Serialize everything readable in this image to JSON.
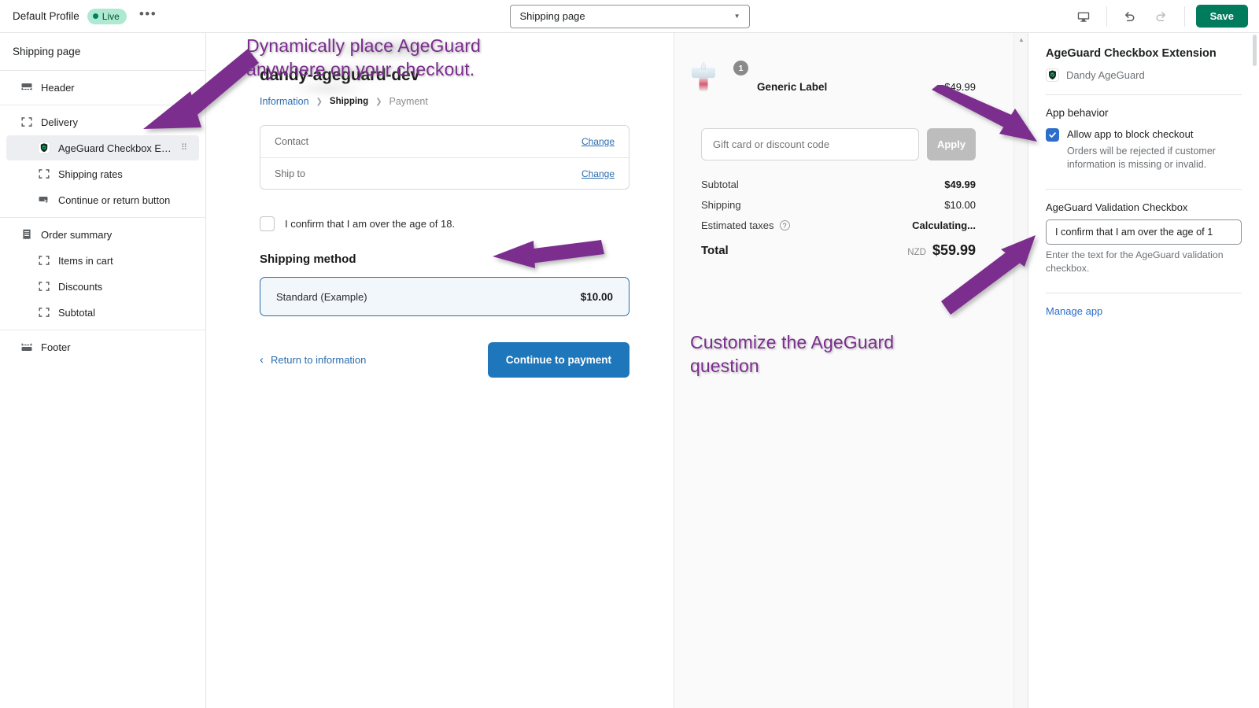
{
  "topbar": {
    "profile_name": "Default Profile",
    "status_badge": "Live",
    "more_label": "•••",
    "page_selector_value": "Shipping page",
    "preview_device_icon": "desktop-monitor-icon",
    "undo_icon": "undo-arrow-icon",
    "redo_icon": "redo-arrow-icon",
    "save_label": "Save",
    "save_color": "#007b5c"
  },
  "sidebar": {
    "title": "Shipping page",
    "groups": [
      {
        "items": [
          {
            "label": "Header",
            "icon": "header-block-icon",
            "level": "parent",
            "selected": false
          }
        ]
      },
      {
        "items": [
          {
            "label": "Delivery",
            "icon": "block-placeholder-icon",
            "level": "parent",
            "selected": false
          },
          {
            "label": "AgeGuard Checkbox Ext...",
            "icon": "ageguard-shield-icon",
            "level": "child",
            "selected": true,
            "drag_handle": "⠿"
          },
          {
            "label": "Shipping rates",
            "icon": "block-placeholder-icon",
            "level": "child",
            "selected": false
          },
          {
            "label": "Continue or return button",
            "icon": "button-cursor-icon",
            "level": "child",
            "selected": false
          }
        ]
      },
      {
        "items": [
          {
            "label": "Order summary",
            "icon": "receipt-icon",
            "level": "parent",
            "selected": false
          },
          {
            "label": "Items in cart",
            "icon": "block-placeholder-icon",
            "level": "child",
            "selected": false
          },
          {
            "label": "Discounts",
            "icon": "block-placeholder-icon",
            "level": "child",
            "selected": false
          },
          {
            "label": "Subtotal",
            "icon": "block-placeholder-icon",
            "level": "child",
            "selected": false
          }
        ]
      },
      {
        "items": [
          {
            "label": "Footer",
            "icon": "footer-block-icon",
            "level": "parent",
            "selected": false
          }
        ]
      }
    ]
  },
  "checkout": {
    "shop_title": "dandy-ageguard-dev",
    "breadcrumbs": [
      {
        "label": "Information",
        "state": "link"
      },
      {
        "label": "Shipping",
        "state": "current"
      },
      {
        "label": "Payment",
        "state": "muted"
      }
    ],
    "breadcrumb_separator": "❯",
    "info_rows": [
      {
        "label": "Contact",
        "value": "",
        "action": "Change"
      },
      {
        "label": "Ship to",
        "value": "",
        "action": "Change"
      }
    ],
    "age_checkbox_label": "I confirm that I am over the age of 18.",
    "age_checkbox_checked": false,
    "shipping_method_heading": "Shipping method",
    "shipping_option": {
      "name": "Standard (Example)",
      "price": "$10.00",
      "selected": true
    },
    "return_link": "Return to information",
    "continue_button": "Continue to payment",
    "continue_button_color": "#1f77bb"
  },
  "order_summary": {
    "product": {
      "name": "Generic Label",
      "price": "$49.99",
      "quantity_badge": "1",
      "image_alt": "bottle-and-glasses-product-thumbnail"
    },
    "discount_placeholder": "Gift card or discount code",
    "discount_value": "",
    "apply_label": "Apply",
    "lines": [
      {
        "label": "Subtotal",
        "value": "$49.99",
        "bold": true,
        "info_icon": false
      },
      {
        "label": "Shipping",
        "value": "$10.00",
        "bold": false,
        "info_icon": false
      },
      {
        "label": "Estimated taxes",
        "value": "Calculating...",
        "bold": true,
        "info_icon": true
      }
    ],
    "total": {
      "label": "Total",
      "currency": "NZD",
      "amount": "$59.99"
    }
  },
  "right_panel": {
    "title": "AgeGuard Checkbox Extension",
    "app_name": "Dandy AgeGuard",
    "app_icon": "ageguard-shield-icon",
    "behavior_section_title": "App behavior",
    "block_checkout_label": "Allow app to block checkout",
    "block_checkout_checked": true,
    "block_checkout_help": "Orders will be rejected if customer information is missing or invalid.",
    "validation_field_label": "AgeGuard Validation Checkbox",
    "validation_field_value": "I confirm that I am over the age of 1",
    "validation_field_help": "Enter the text for the AgeGuard validation checkbox.",
    "manage_app_link": "Manage app",
    "checkbox_color": "#2c6ecb",
    "link_color": "#2c6ecb"
  },
  "annotations": [
    {
      "text": "Dynamically place AgeGuard\nanywhere on your checkout.",
      "color": "#7b2d8e"
    },
    {
      "text": "Customize the AgeGuard\nquestion",
      "color": "#7b2d8e"
    }
  ],
  "annotation_color": "#7b2d8e"
}
